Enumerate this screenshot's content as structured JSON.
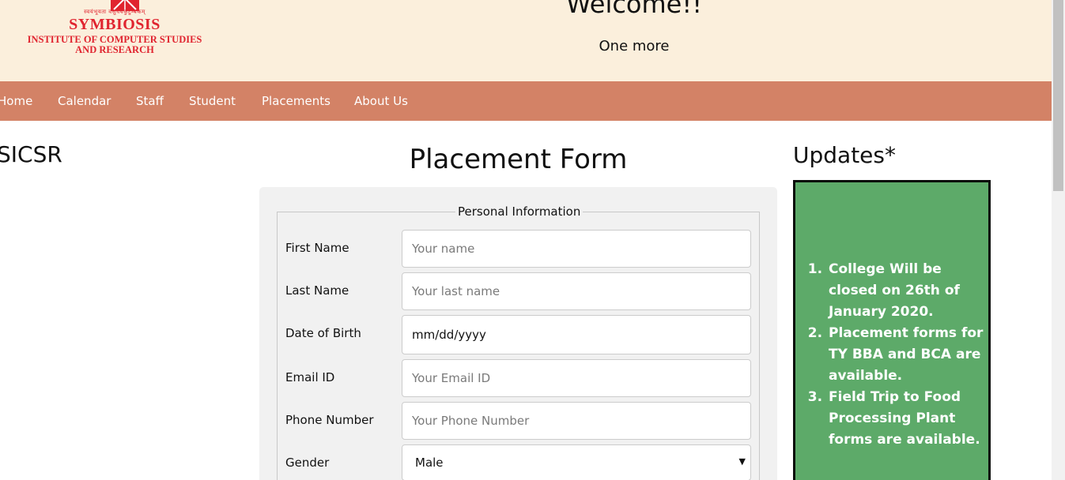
{
  "header": {
    "logo": {
      "hindi": "स्वयंभूयता वसुधैवकुटुम्बकम्",
      "title": "SYMBIOSIS",
      "subtitle_line1": "INSTITUTE OF COMPUTER STUDIES",
      "subtitle_line2": "AND RESEARCH"
    },
    "welcome": "Welcome!!",
    "subtitle": "One more"
  },
  "nav": {
    "items": [
      "Home",
      "Calendar",
      "Staff",
      "Student",
      "Placements",
      "About Us"
    ]
  },
  "sidebar": {
    "title": "SICSR"
  },
  "form": {
    "title": "Placement Form",
    "legend": "Personal Information",
    "fields": [
      {
        "label": "First Name",
        "placeholder": "Your name"
      },
      {
        "label": "Last Name",
        "placeholder": "Your last name"
      },
      {
        "label": "Date of Birth",
        "value": "mm/dd/yyyy"
      },
      {
        "label": "Email ID",
        "placeholder": "Your Email ID"
      },
      {
        "label": "Phone Number",
        "placeholder": "Your Phone Number"
      },
      {
        "label": "Gender",
        "selected": "Male"
      }
    ]
  },
  "updates": {
    "title": "Updates*",
    "items": [
      "College Will be closed on 26th of January 2020.",
      "Placement forms for TY BBA and BCA are available.",
      "Field Trip to Food Processing Plant forms are available."
    ]
  },
  "colors": {
    "header_bg": "#fbefdc",
    "nav_bg": "#d38266",
    "updates_bg": "#5daa69",
    "logo_red": "#e0242f"
  }
}
